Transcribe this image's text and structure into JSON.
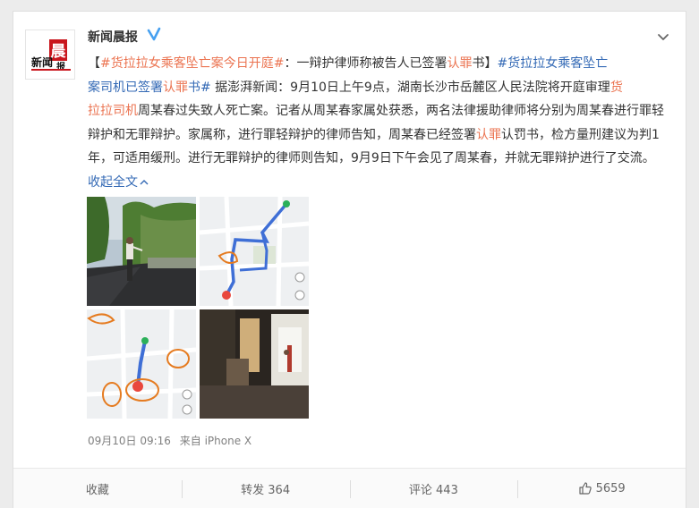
{
  "post": {
    "user_name": "新闻晨报",
    "avatar_text": "新闻晨报",
    "content": {
      "p1": "【",
      "topic1": "#货拉拉女乘客坠亡案今日开庭#",
      "p2": "：一辩护律师称被告人已签署",
      "kw1": "认罪",
      "p3": "书】",
      "topic2a": "#货拉拉女乘客坠亡",
      "topic2b": "案司机已签署",
      "kw2": "认罪",
      "topic2c": "书#",
      "p4": " 据澎湃新闻：9月10日上午9点，湖南长沙市岳麓区人民法院将开庭审理",
      "kw3": "货",
      "kw3b": "拉拉司机",
      "p5": "周某春过失致人死亡案。记者从周某春家属处获悉，两名法律援助律师将分别为周某春进行罪轻辩护和无罪辩护。家属称，进行罪轻辩护的律师告知，周某春已经签署",
      "kw4": "认罪",
      "p6": "认罚书，检方量刑建议为判1年，可适用缓刑。进行无罪辩护的律师则告知，9月9日下午会见了周某春，并就无罪辩护进行了交流。",
      "collapse": "收起全文"
    },
    "meta": {
      "time": "09月10日 09:16",
      "source": "来自 iPhone X"
    }
  },
  "actions": {
    "favorite": "收藏",
    "repost": "转发 364",
    "comment": "评论 443",
    "like": "5659"
  },
  "colors": {
    "topic": "#eb7350",
    "link": "#3369b5",
    "verified": "#46a0f0"
  }
}
